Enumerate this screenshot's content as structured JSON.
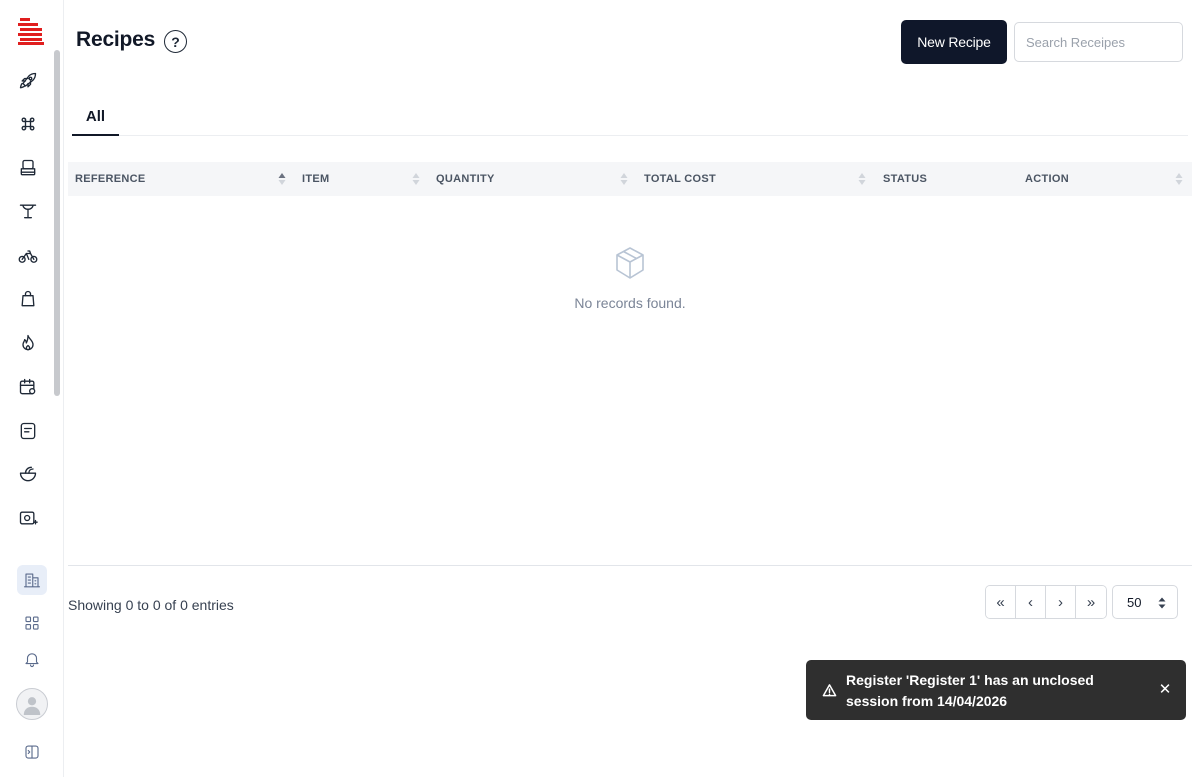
{
  "header": {
    "title": "Recipes",
    "help_glyph": "?",
    "new_button_label": "New Recipe",
    "search_placeholder": "Search Receipes"
  },
  "tabs": [
    {
      "label": "All",
      "active": true
    }
  ],
  "table": {
    "columns": [
      {
        "label": "REFERENCE",
        "sortable": true,
        "sort": "asc"
      },
      {
        "label": "ITEM",
        "sortable": true,
        "sort": "none"
      },
      {
        "label": "QUANTITY",
        "sortable": true,
        "sort": "none"
      },
      {
        "label": "TOTAL COST",
        "sortable": true,
        "sort": "none"
      },
      {
        "label": "STATUS",
        "sortable": false,
        "sort": "none"
      },
      {
        "label": "ACTION",
        "sortable": true,
        "sort": "none"
      }
    ],
    "rows": [],
    "empty_text": "No records found.",
    "empty_icon": "box-icon"
  },
  "footer": {
    "entries_text": "Showing 0 to 0 of 0 entries",
    "pager": {
      "first": "«",
      "prev": "‹",
      "next": "›",
      "last": "»"
    },
    "per_page": "50"
  },
  "toast": {
    "message": "Register 'Register 1' has an unclosed session from 14/04/2026",
    "close_glyph": "✕",
    "icon": "warning-triangle-icon"
  },
  "sidebar": {
    "nav_icons": [
      "rocket-icon",
      "command-icon",
      "register-icon",
      "table-icon",
      "bike-icon",
      "bag-icon",
      "flame-icon",
      "calendar-settings-icon",
      "receipt-icon",
      "bowl-icon",
      "photo-plus-icon"
    ],
    "bottom_icons": [
      "building-icon",
      "apps-icon",
      "bell-icon",
      "user-avatar",
      "sidebar-toggle-icon"
    ]
  },
  "colors": {
    "primary_button": "#0f172a",
    "toast_bg": "#2f2f2f",
    "logo_red": "#e01e1e",
    "active_bottom_bg": "#e8eef8"
  }
}
